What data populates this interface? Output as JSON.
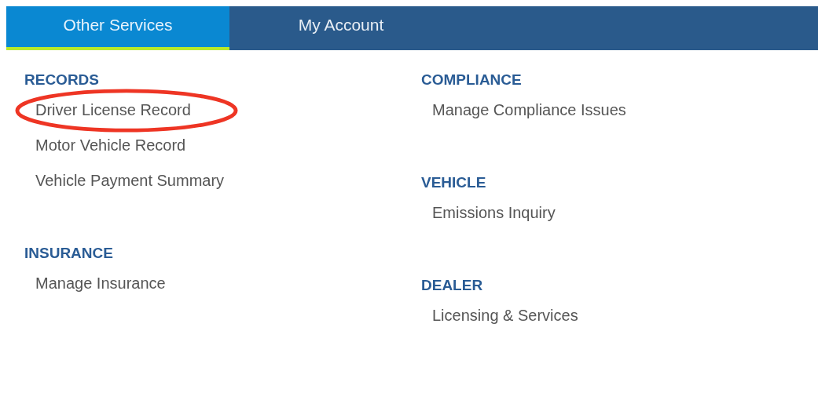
{
  "tabs": [
    {
      "label": "Other Services",
      "selected": true
    },
    {
      "label": "My Account",
      "selected": false
    }
  ],
  "columns": [
    [
      {
        "heading": "RECORDS",
        "items": [
          {
            "label": "Driver License Record",
            "highlighted": true
          },
          {
            "label": "Motor Vehicle Record",
            "highlighted": false
          },
          {
            "label": "Vehicle Payment Summary",
            "highlighted": false
          }
        ]
      },
      {
        "heading": "INSURANCE",
        "items": [
          {
            "label": "Manage Insurance",
            "highlighted": false
          }
        ]
      }
    ],
    [
      {
        "heading": "COMPLIANCE",
        "items": [
          {
            "label": "Manage Compliance Issues",
            "highlighted": false
          }
        ]
      },
      {
        "heading": "VEHICLE",
        "items": [
          {
            "label": "Emissions Inquiry",
            "highlighted": false
          }
        ]
      },
      {
        "heading": "DEALER",
        "items": [
          {
            "label": "Licensing & Services",
            "highlighted": false
          }
        ]
      }
    ]
  ]
}
